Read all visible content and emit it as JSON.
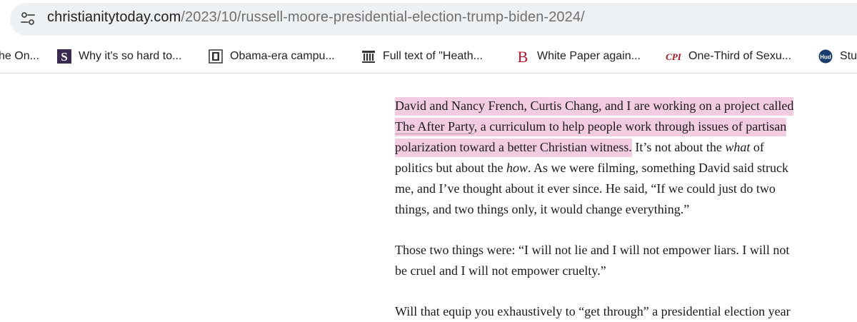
{
  "address_bar": {
    "url_domain": "christianitytoday.com",
    "url_path": "/2023/10/russell-moore-presidential-election-trump-biden-2024/",
    "site_info_icon": "tune-icon"
  },
  "bookmarks": [
    {
      "label": "he On...",
      "icon": "none"
    },
    {
      "label": "Why it's so hard to...",
      "icon": "s-logo-icon"
    },
    {
      "label": "Obama-era campu...",
      "icon": "newspaper-logo-icon"
    },
    {
      "label": "Full text of \"Heath...",
      "icon": "archive-icon"
    },
    {
      "label": "White Paper again...",
      "icon": "b-logo-icon"
    },
    {
      "label": "One-Third of Sexu...",
      "icon": "cpi-logo-icon"
    },
    {
      "label": "Stu",
      "icon": "hud-logo-icon"
    }
  ],
  "bookmark_icon_text": {
    "s": "S",
    "b": "B",
    "cpi": "CPI",
    "hud": "Hud"
  },
  "article": {
    "p1": {
      "l1": "David and Nancy French, Curtis Chang, and I are working on a project called",
      "l2_link": "The After Party",
      "l2_rest": ", a curriculum to help people work through issues of partisan",
      "l3_hl": "polarization toward a better Christian witness.",
      "l3_rest_a": " It’s not about the ",
      "l3_em": "what",
      "l3_rest_b": " of",
      "l4_a": "politics but about the ",
      "l4_em": "how",
      "l4_b": ". As we were filming, something David said struck",
      "l5": "me, and I’ve thought about it ever since. He said, “If we could just do two",
      "l6": "things, and two things only, it would change everything.”"
    },
    "p2": {
      "l1": "Those two things were: “I will not lie and I will not empower liars. I will not",
      "l2": "be cruel and I will not empower cruelty.”"
    },
    "p3": {
      "l1": "Will that equip you exhaustively to “get through” a presidential election year"
    }
  },
  "colors": {
    "highlight": "#f4cce2",
    "url_bar_bg": "#eef1f4"
  }
}
